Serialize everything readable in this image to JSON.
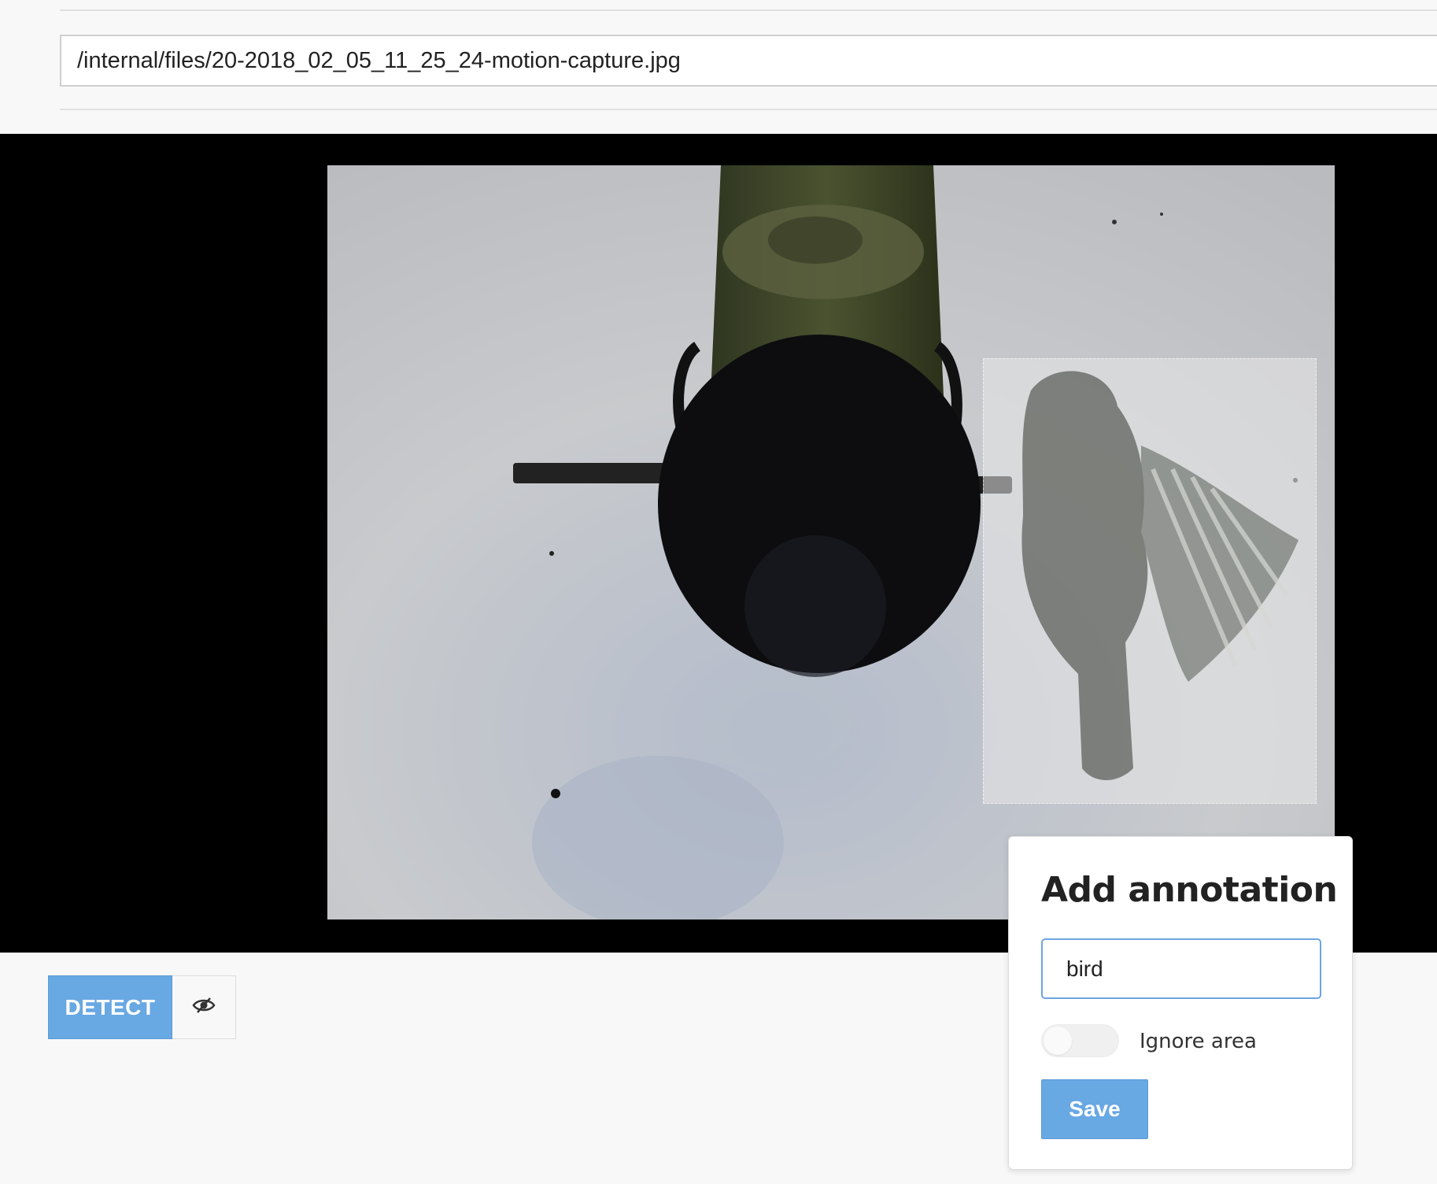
{
  "file_path": {
    "value": "/internal/files/20-2018_02_05_11_25_24-motion-capture.jpg"
  },
  "viewer": {
    "image_subject": "bird-feeder-capture",
    "annotation_label": "bird"
  },
  "toolbar": {
    "detect_label": "DETECT",
    "visibility_icon": "eye-slash-icon"
  },
  "annotation_popup": {
    "title": "Add annotation",
    "label_value": "bird",
    "ignore_area_label": "Ignore area",
    "ignore_area_enabled": false,
    "save_label": "Save"
  },
  "colors": {
    "accent": "#68a8e3",
    "viewer_background": "#000000",
    "page_background": "#f8f8f8"
  }
}
